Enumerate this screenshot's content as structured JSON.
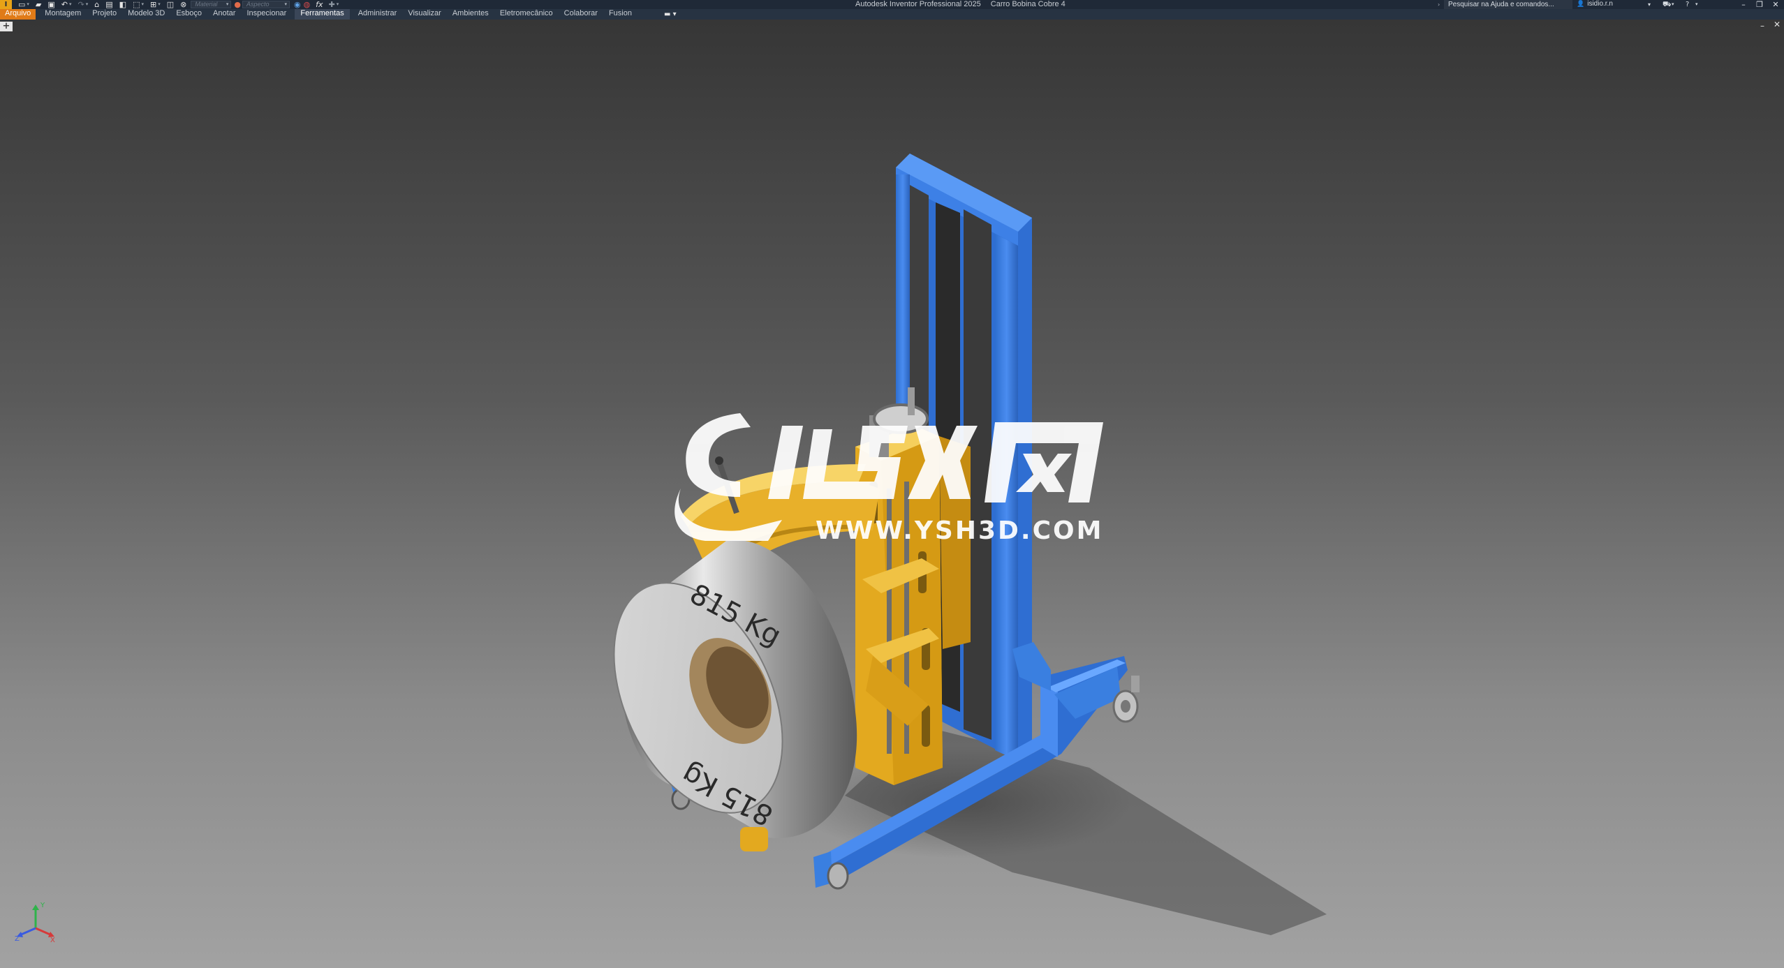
{
  "app": {
    "badge": "I",
    "title": "Autodesk Inventor Professional 2025",
    "document": "Carro Bobina Cobre 4"
  },
  "quick_access": {
    "material_placeholder": "Material",
    "appearance_placeholder": "Aspecto",
    "fx_label": "fx"
  },
  "help": {
    "search_label": "Pesquisar na Ajuda e comandos..."
  },
  "user": {
    "name": "isidio.r.n"
  },
  "ribbon": {
    "file_tab": "Arquivo",
    "tabs": [
      "Montagem",
      "Projeto",
      "Modelo 3D",
      "Esboço",
      "Anotar",
      "Inspecionar",
      "Ferramentas",
      "Administrar",
      "Visualizar",
      "Ambientes",
      "Eletromecânico",
      "Colaborar",
      "Fusion"
    ],
    "active_tab": "Ferramentas"
  },
  "model": {
    "coil_label": "815 Kg"
  },
  "watermark": {
    "url": "WWW.YSH3D.COM"
  },
  "axis_labels": {
    "x": "X",
    "y": "Y",
    "z": "Z"
  },
  "colors": {
    "frame_blue": "#3a7fe0",
    "carriage_yellow": "#e9b42c",
    "coil_silver": "#c9c9c9",
    "file_tab": "#e07b18"
  }
}
